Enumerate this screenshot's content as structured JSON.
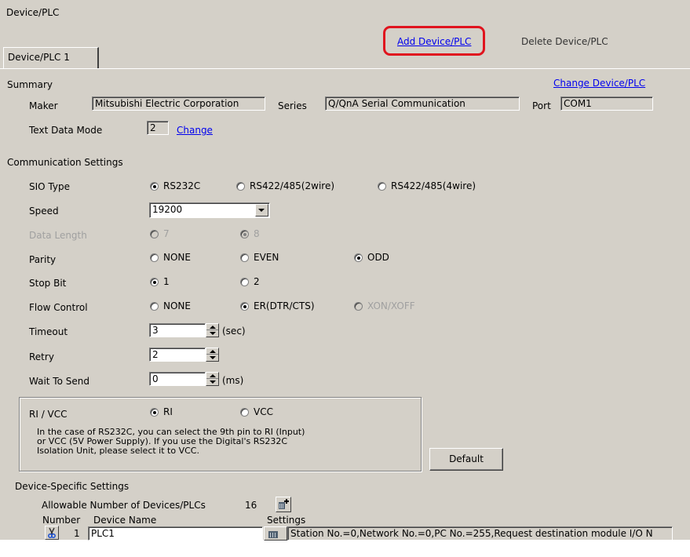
{
  "window": {
    "title": "Device/PLC"
  },
  "top_actions": {
    "add": "Add Device/PLC",
    "delete": "Delete Device/PLC"
  },
  "tabs": [
    {
      "label": "Device/PLC 1"
    }
  ],
  "summary": {
    "heading": "Summary",
    "change_link": "Change Device/PLC",
    "maker_label": "Maker",
    "maker_value": "Mitsubishi Electric Corporation",
    "series_label": "Series",
    "series_value": "Q/QnA Serial Communication",
    "port_label": "Port",
    "port_value": "COM1",
    "text_mode_label": "Text Data Mode",
    "text_mode_value": "2",
    "text_mode_change": "Change"
  },
  "comm": {
    "heading": "Communication Settings",
    "sio_label": "SIO Type",
    "sio_options": [
      "RS232C",
      "RS422/485(2wire)",
      "RS422/485(4wire)"
    ],
    "sio_selected": "RS232C",
    "speed_label": "Speed",
    "speed_value": "19200",
    "data_length_label": "Data Length",
    "data_length_options": [
      "7",
      "8"
    ],
    "data_length_selected": "8",
    "parity_label": "Parity",
    "parity_options": [
      "NONE",
      "EVEN",
      "ODD"
    ],
    "parity_selected": "ODD",
    "stop_label": "Stop Bit",
    "stop_options": [
      "1",
      "2"
    ],
    "stop_selected": "1",
    "flow_label": "Flow Control",
    "flow_options": [
      "NONE",
      "ER(DTR/CTS)",
      "XON/XOFF"
    ],
    "flow_selected": "ER(DTR/CTS)",
    "timeout_label": "Timeout",
    "timeout_value": "3",
    "timeout_unit": "(sec)",
    "retry_label": "Retry",
    "retry_value": "2",
    "wait_label": "Wait To Send",
    "wait_value": "0",
    "wait_unit": "(ms)",
    "rivcc_label": "RI / VCC",
    "rivcc_options": [
      "RI",
      "VCC"
    ],
    "rivcc_selected": "RI",
    "rivcc_note_1": "In the case of RS232C, you can select the 9th pin to RI (Input)",
    "rivcc_note_2": "or VCC (5V Power Supply). If you use the Digital's RS232C",
    "rivcc_note_3": "Isolation Unit, please select it to VCC.",
    "default_button": "Default"
  },
  "device_specific": {
    "heading": "Device-Specific Settings",
    "allowable_label": "Allowable Number of Devices/PLCs",
    "allowable_value": "16",
    "col_number": "Number",
    "col_device_name": "Device Name",
    "col_settings": "Settings",
    "row_number": "1",
    "row_device_name": "PLC1",
    "row_settings": "Station No.=0,Network No.=0,PC No.=255,Request destination module I/O N"
  },
  "icons": [
    "scissors-icon",
    "plc-settings-icon",
    "add-plc-icon",
    "dropdown-arrow-icon"
  ],
  "colors": {
    "highlight": "#e0141e",
    "link": "#0000ee",
    "panel": "#d4d0c8"
  }
}
